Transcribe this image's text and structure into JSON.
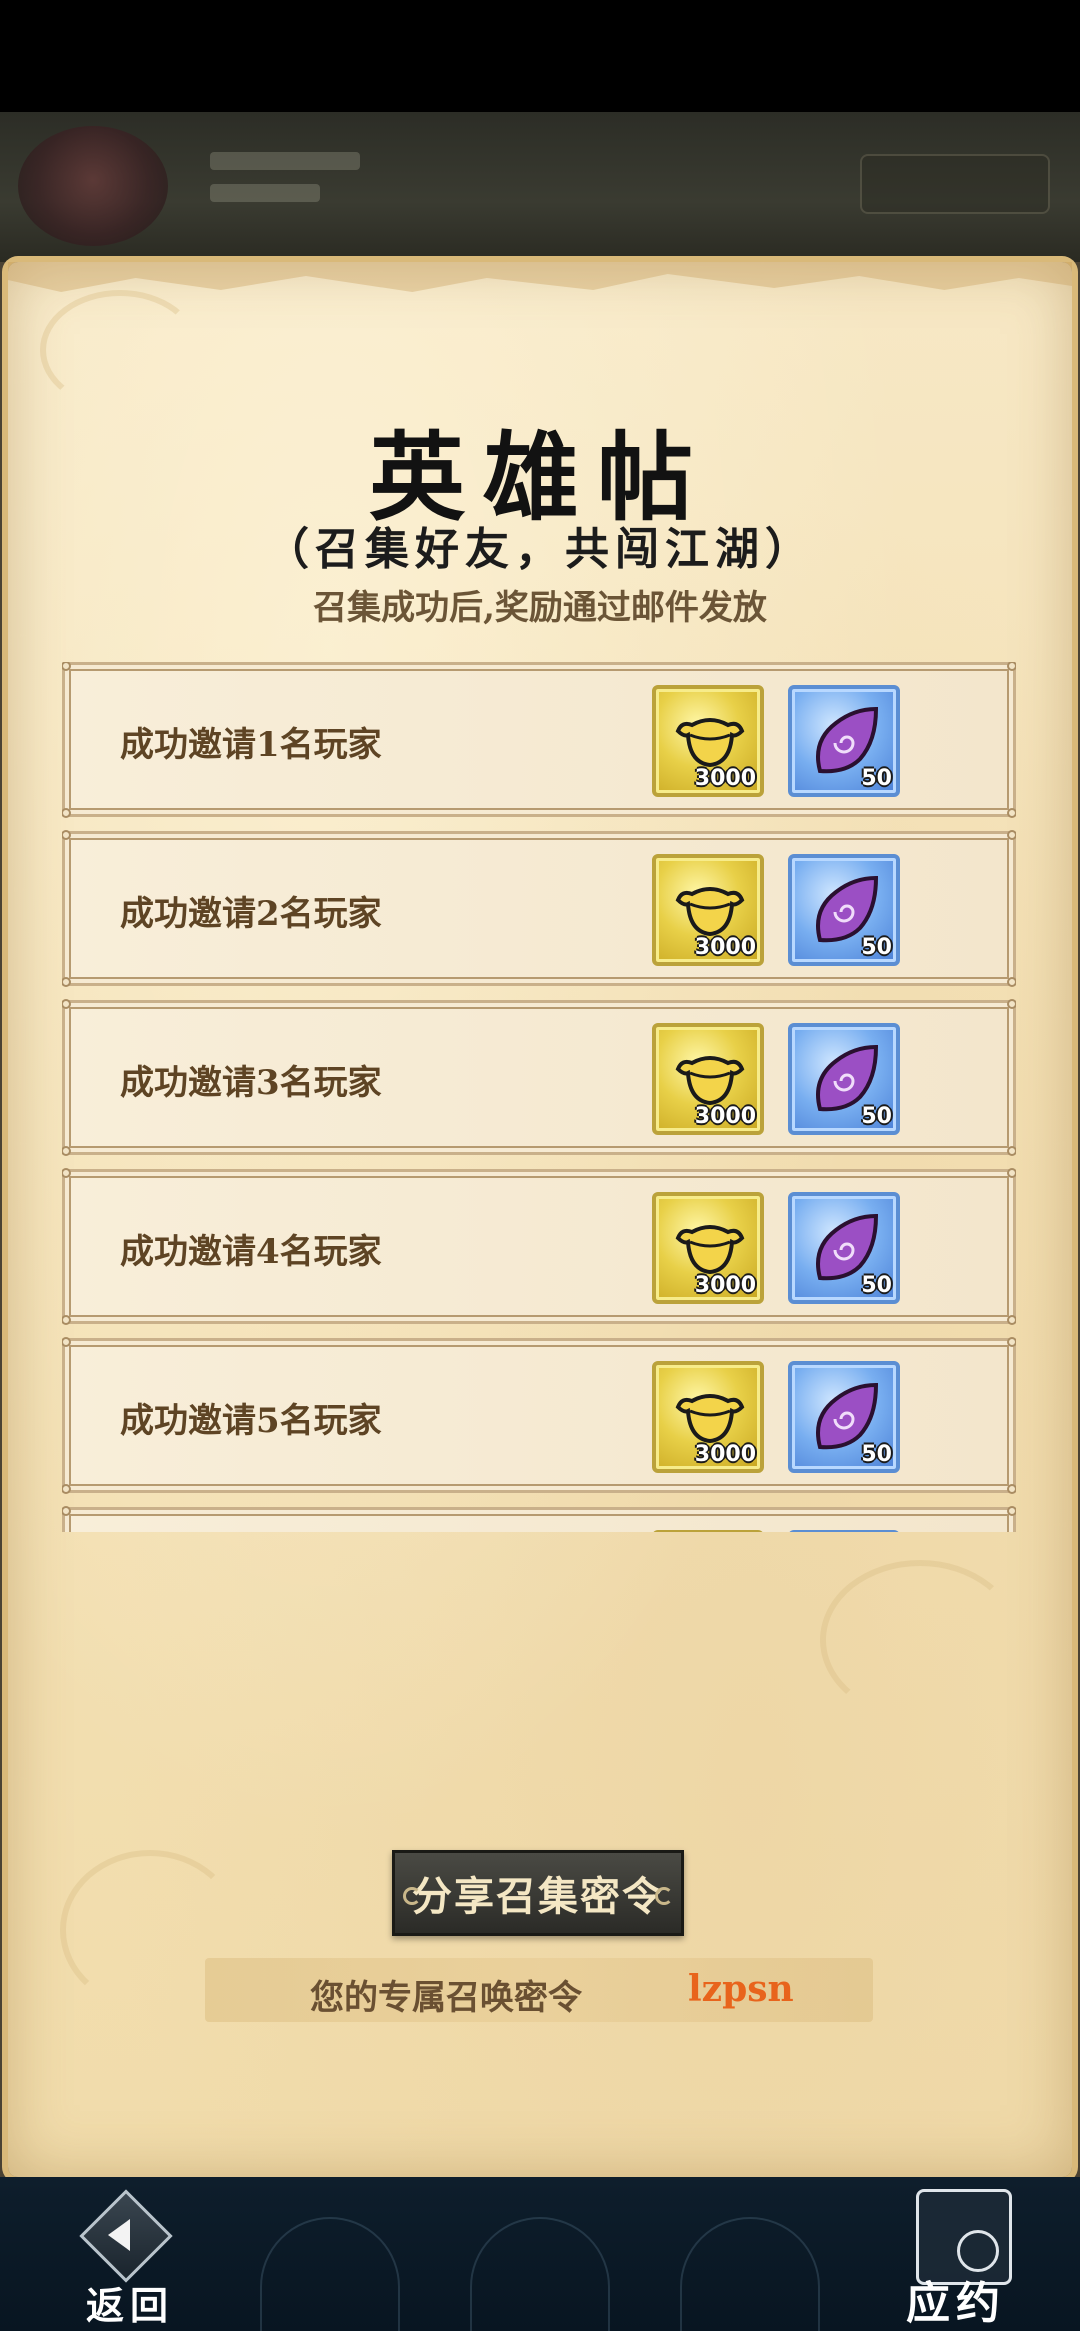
{
  "header": {
    "title": "英雄帖",
    "subtitle": "（召集好友，共闯江湖）",
    "note": "召集成功后,奖励通过邮件发放"
  },
  "rewards": [
    {
      "label": "成功邀请1名玩家",
      "items": [
        {
          "icon": "gold-ingot-icon",
          "count": "3000"
        },
        {
          "icon": "purple-gem-icon",
          "count": "50"
        }
      ]
    },
    {
      "label": "成功邀请2名玩家",
      "items": [
        {
          "icon": "gold-ingot-icon",
          "count": "3000"
        },
        {
          "icon": "purple-gem-icon",
          "count": "50"
        }
      ]
    },
    {
      "label": "成功邀请3名玩家",
      "items": [
        {
          "icon": "gold-ingot-icon",
          "count": "3000"
        },
        {
          "icon": "purple-gem-icon",
          "count": "50"
        }
      ]
    },
    {
      "label": "成功邀请4名玩家",
      "items": [
        {
          "icon": "gold-ingot-icon",
          "count": "3000"
        },
        {
          "icon": "purple-gem-icon",
          "count": "50"
        }
      ]
    },
    {
      "label": "成功邀请5名玩家",
      "items": [
        {
          "icon": "gold-ingot-icon",
          "count": "3000"
        },
        {
          "icon": "purple-gem-icon",
          "count": "50"
        }
      ]
    },
    {
      "label": "",
      "items": [
        {
          "icon": "gold-ingot-icon",
          "count": ""
        },
        {
          "icon": "purple-gem-icon",
          "count": ""
        }
      ]
    }
  ],
  "share": {
    "button_label": "分享召集密令",
    "code_label": "您的专属召唤密令",
    "code_value": "lzpsn"
  },
  "footer": {
    "back_label": "返回",
    "pledge_label": "应约"
  },
  "colors": {
    "code_value": "#e8641c",
    "paper": "#f4e1b6",
    "bottom_bar": "#0e1e2c"
  }
}
